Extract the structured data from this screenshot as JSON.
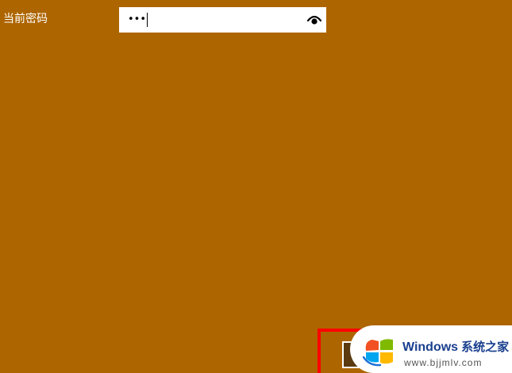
{
  "form": {
    "current_password_label": "当前密码",
    "current_password_value": "•••"
  },
  "icons": {
    "reveal": "eye-icon",
    "logo": "windows-logo-icon"
  },
  "watermark": {
    "brand": "Windows",
    "brand_cn": "系统之家",
    "url": "www.bjjmlv.com"
  },
  "colors": {
    "background": "#ad6500",
    "highlight": "#ff0000",
    "brand": "#1a3f8f"
  }
}
